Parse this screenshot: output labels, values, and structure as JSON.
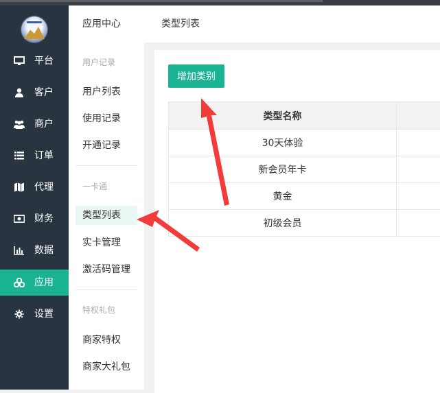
{
  "sidebar": {
    "logo_icon": "logo-emblem",
    "items": [
      {
        "label": "平台",
        "icon": "monitor-icon"
      },
      {
        "label": "客户",
        "icon": "user-icon"
      },
      {
        "label": "商户",
        "icon": "users-icon"
      },
      {
        "label": "订单",
        "icon": "list-icon"
      },
      {
        "label": "代理",
        "icon": "map-icon"
      },
      {
        "label": "财务",
        "icon": "money-icon"
      },
      {
        "label": "数据",
        "icon": "bar-chart-icon"
      },
      {
        "label": "应用",
        "icon": "cubes-icon",
        "active": true
      },
      {
        "label": "设置",
        "icon": "gear-icon"
      }
    ],
    "active_color": "#1ab394",
    "bg_color": "#283541"
  },
  "subnav": {
    "title": "应用中心",
    "groups": [
      {
        "label": "用户记录",
        "items": [
          "用户列表",
          "使用记录",
          "开通记录"
        ]
      },
      {
        "label": "一卡通",
        "items": [
          "类型列表",
          "实卡管理",
          "激活码管理"
        ]
      },
      {
        "label": "特权礼包",
        "items": [
          "商家特权",
          "商家大礼包"
        ]
      }
    ],
    "active_item": "类型列表"
  },
  "header": {
    "breadcrumb": "类型列表"
  },
  "main": {
    "add_button": "增加类别",
    "table": {
      "columns": [
        "类型名称",
        ""
      ],
      "rows": [
        [
          "30天体验",
          ""
        ],
        [
          "新会员年卡",
          ""
        ],
        [
          "黄金",
          ""
        ],
        [
          "初级会员",
          ""
        ]
      ]
    }
  }
}
